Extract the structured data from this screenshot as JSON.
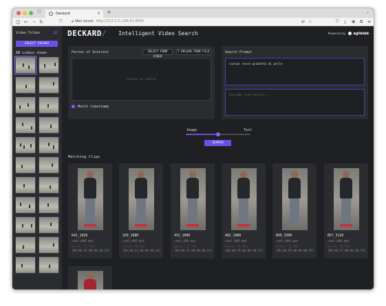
{
  "browser": {
    "tab_title": "Deckard",
    "url_security": "Non sicuro",
    "url_host": "http://213.171.185.81:8000"
  },
  "sidebar": {
    "title": "Video Folder",
    "select_folder_label": "SELECT FOLDER",
    "videos_count": "28",
    "videos_count_suffix": "videos shown"
  },
  "header": {
    "logo": "DECKARD",
    "logo_slash": "/",
    "subtitle": "Intelligent Video Search",
    "powered_by": "Powered by",
    "brand": "agilelab"
  },
  "person_panel": {
    "title": "Person of Interest",
    "select_from_video_label": "SELECT FROM VIDEO",
    "upload_from_file_label": "UPLOAD FROM FILE",
    "drop_placeholder": "Choose an option",
    "match_timestamp_label": "Match timestamp",
    "match_timestamp_checked": true
  },
  "prompt_panel": {
    "title": "Search Prompt",
    "prompt_value": "scarpe rosse giubotto di pelle",
    "exclude_placeholder": "Exclude from results..."
  },
  "weight_slider": {
    "left_label": "Image",
    "right_label": "Text",
    "value": 0.5
  },
  "search_label": "SEARCH",
  "results": {
    "title": "Matching Clips",
    "clips": [
      {
        "id": "642_1920",
        "file": "cam1_000.mp4",
        "score": "Score: 71.43%",
        "time": "[00:00:25:00-00:00:26]"
      },
      {
        "id": "329_1680",
        "file": "cam1_000.mp4",
        "score": "Score: 70.86%",
        "time": "[00:00:21:00-00:00:24]"
      },
      {
        "id": "431_1080",
        "file": "cam1_000.mp4",
        "score": "Score: 71.22%",
        "time": "[00:00:21:00-00:00:24]"
      },
      {
        "id": "462_1080",
        "file": "cam1_000.mp4",
        "score": "Score: 71.05%",
        "time": "[00:00:19:00-00:00:21]"
      },
      {
        "id": "899_3360",
        "file": "cam1_000.mp4",
        "score": "Score: 71.00%",
        "time": "[00:00:59:00-00:00:59]"
      },
      {
        "id": "857_3120",
        "file": "cam1_000.mp4",
        "score": "Score: 70.93%",
        "time": "[00:00:57:00-00:00:59]"
      }
    ]
  }
}
